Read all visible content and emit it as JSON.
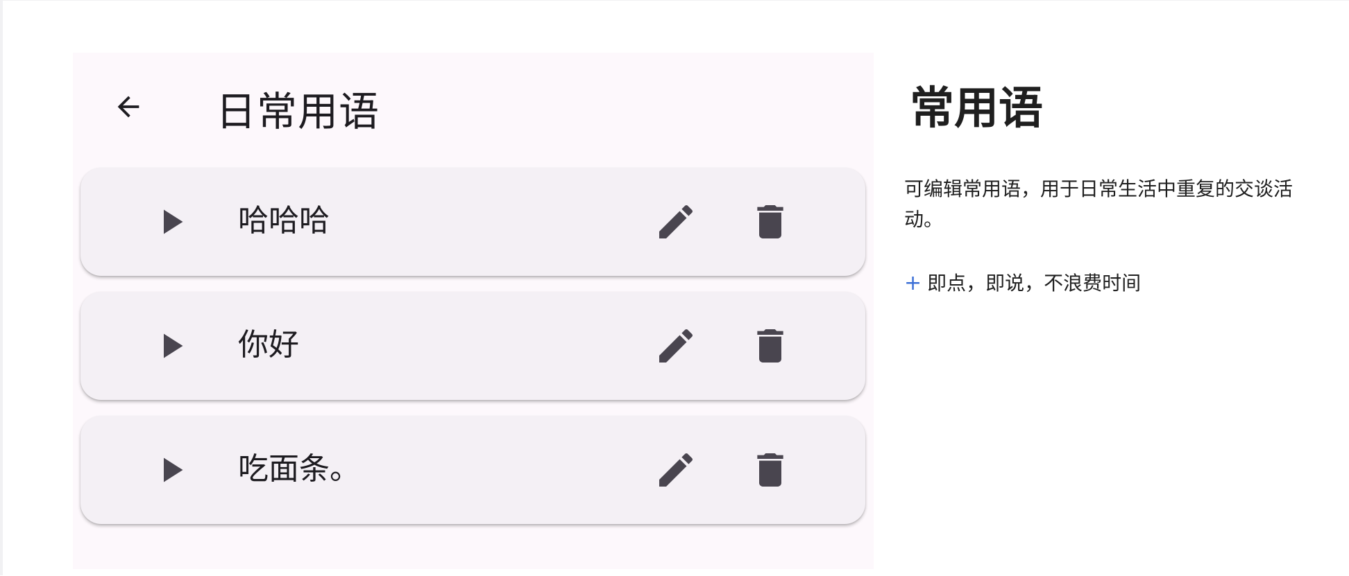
{
  "appbar": {
    "back_icon": "arrow-back-icon",
    "title": "日常用语"
  },
  "phrases": [
    {
      "text": "哈哈哈",
      "play_icon": "play-icon",
      "edit_icon": "edit-pencil-icon",
      "delete_icon": "trash-icon"
    },
    {
      "text": "你好",
      "play_icon": "play-icon",
      "edit_icon": "edit-pencil-icon",
      "delete_icon": "trash-icon"
    },
    {
      "text": "吃面条。",
      "play_icon": "play-icon",
      "edit_icon": "edit-pencil-icon",
      "delete_icon": "trash-icon"
    }
  ],
  "side": {
    "title": "常用语",
    "description": "可编辑常用语，用于日常生活中重复的交谈活动。",
    "feature_bullet": "+",
    "feature_text": "即点，即说，不浪费时间"
  },
  "colors": {
    "phone_bg": "#fdf8fc",
    "card_bg": "#f4f0f5",
    "icon": "#49454f",
    "text": "#1d1b20",
    "accent": "#3b6fd6"
  }
}
